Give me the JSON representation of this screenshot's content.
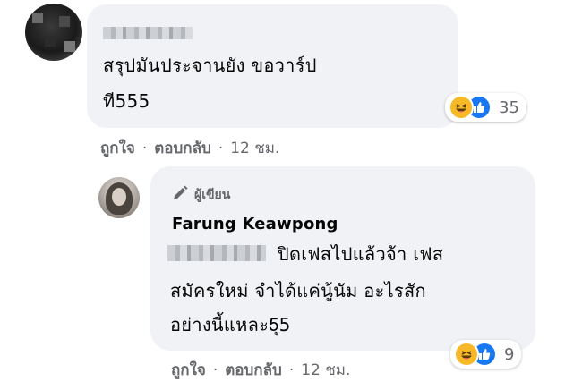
{
  "comment": {
    "avatar_icon": "user-avatar-blurred",
    "text_line1": "สรุปมันประจานยัง ขอวาร์ป",
    "text_line2": "ที555",
    "reactions": {
      "icons": [
        "haha-icon",
        "like-icon"
      ],
      "count": "35"
    },
    "actions": {
      "like": "ถูกใจ",
      "reply": "ตอบกลับ",
      "time": "12 ชม.",
      "separator": "·"
    }
  },
  "reply": {
    "avatar_icon": "user-avatar",
    "badge_label": "ผู้เขียน",
    "badge_icon": "pen-icon",
    "author_name": "Farung Keawpong",
    "text_line1": "ปิดเฟสไปแล้วจ้า เฟส",
    "text_line2": "สมัครใหม่ จำได้แค่นู้นัม อะไรสัก",
    "text_line3": "อย่างนี้แหละ5ุ5",
    "reactions": {
      "icons": [
        "haha-icon",
        "like-icon"
      ],
      "count": "9"
    },
    "actions": {
      "like": "ถูกใจ",
      "reply": "ตอบกลับ",
      "time": "12 ชม.",
      "separator": "·"
    }
  },
  "colors": {
    "bubble": "#f0f2f5",
    "meta_text": "#65676b",
    "like_blue": "#1877f2",
    "haha_yellow": "#f7b928"
  }
}
